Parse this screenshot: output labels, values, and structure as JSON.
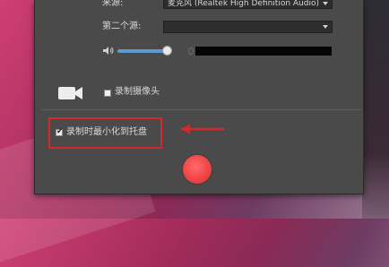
{
  "source": {
    "label": "来源:",
    "value": "麦克风 (Realtek High Definition Audio)"
  },
  "second_source": {
    "label": "第二个源:",
    "value": ""
  },
  "volume": {
    "level": 0.86
  },
  "camera": {
    "label": "录制摄像头",
    "checked": false
  },
  "minimize": {
    "label": "录制时最小化到托盘",
    "checked": true
  },
  "colors": {
    "panel": "#4a4a4a",
    "accent_blue": "#5e98d2",
    "highlight_red": "#d62828",
    "record_red": "#f04545"
  }
}
